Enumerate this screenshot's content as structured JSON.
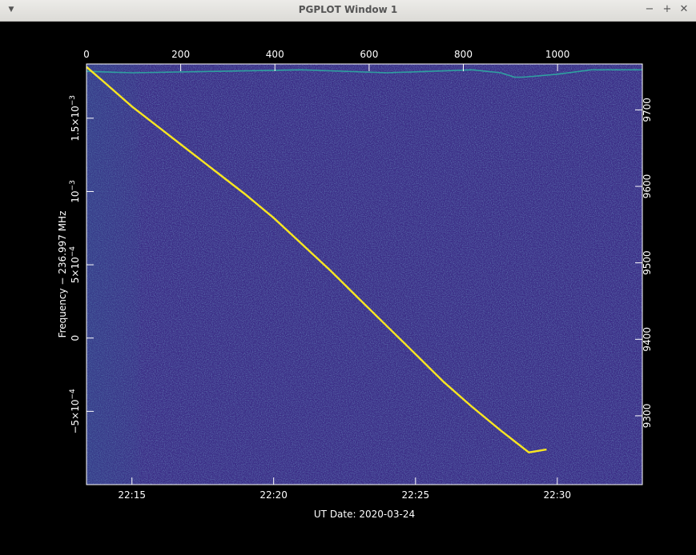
{
  "window": {
    "title": "PGPLOT Window 1",
    "menu_icon": "triangle-down-icon",
    "minimize_icon": "minus-icon",
    "maximize_icon": "plus-icon",
    "close_icon": "x-icon"
  },
  "colors": {
    "background": "#000000",
    "colormap_low": "#3b2d86",
    "trace": "#f8e621",
    "upper_trace": "#2fa0a0",
    "axes": "#ffffff"
  },
  "chart_data": {
    "type": "heatmap",
    "title": "",
    "xlabel": "UT Date: 2020-03-24",
    "ylabel": "Frequency − 236.997 MHz",
    "x_ticks": [
      "22:15",
      "22:20",
      "22:25",
      "22:30"
    ],
    "x_tick_values_hours": [
      22.25,
      22.3333,
      22.4167,
      22.5
    ],
    "xlim_hours": [
      22.2233,
      22.55
    ],
    "top_ticks": [
      "0",
      "200",
      "400",
      "600",
      "800",
      "1000"
    ],
    "top_tick_values": [
      0,
      200,
      400,
      600,
      800,
      1000
    ],
    "top_lim": [
      0,
      1180
    ],
    "y_ticks": [
      {
        "mant": "1.5×10",
        "exp": "−3",
        "value": 0.0015
      },
      {
        "mant": "10",
        "exp": "−3",
        "value": 0.001
      },
      {
        "mant": "5×10",
        "exp": "−4",
        "value": 0.0005
      },
      {
        "mant": "0",
        "exp": "",
        "value": 0
      },
      {
        "mant": "−5×10",
        "exp": "−4",
        "value": -0.0005
      }
    ],
    "ylim": [
      -0.001,
      0.00187
    ],
    "right_ticks": [
      "9300",
      "9400",
      "9500",
      "9600",
      "9700"
    ],
    "right_tick_values": [
      9300,
      9400,
      9500,
      9600,
      9700
    ],
    "right_lim": [
      9210,
      9760
    ],
    "series": [
      {
        "x": [
          22.2233,
          22.2333,
          22.25,
          22.2667,
          22.2833,
          22.3,
          22.3167,
          22.3333,
          22.35,
          22.3667,
          22.3833,
          22.4,
          22.4167,
          22.4333,
          22.45,
          22.4667,
          22.4833,
          22.4937
        ],
        "y": [
          0.00185,
          0.00175,
          0.00158,
          0.00143,
          0.00128,
          0.00113,
          0.00098,
          0.00082,
          0.00064,
          0.00046,
          0.00027,
          8e-05,
          -0.00011,
          -0.0003,
          -0.00047,
          -0.00063,
          -0.00078,
          -0.00076
        ]
      }
    ],
    "upper_trace": {
      "x": [
        22.2233,
        22.25,
        22.3,
        22.35,
        22.4,
        22.45,
        22.4667,
        22.475,
        22.48,
        22.5,
        22.52,
        22.55
      ],
      "y": [
        0.00182,
        0.00181,
        0.00182,
        0.00183,
        0.00181,
        0.00183,
        0.00181,
        0.00178,
        0.00178,
        0.0018,
        0.00183,
        0.00183
      ]
    },
    "colorbar": false,
    "grid": false
  }
}
